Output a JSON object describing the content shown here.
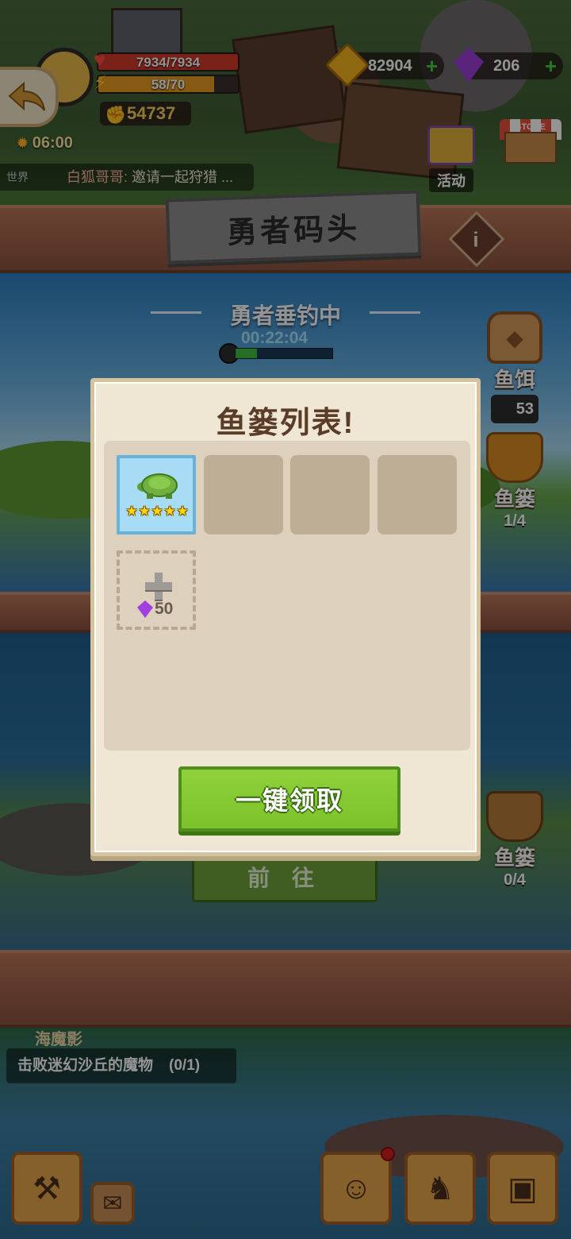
{
  "hud": {
    "hp": "7934/7934",
    "xp": "58/70",
    "power": "54737",
    "clock": "06:00",
    "gold": "82904",
    "gems": "206",
    "chat_channel": "世界",
    "chat_name": "白狐哥哥:",
    "chat_text": " 邀请一起狩猎 ...",
    "activity_label": "活动",
    "store_label": "STORE"
  },
  "header": {
    "title": "勇者码头",
    "info_label": "i"
  },
  "fishing": {
    "status": "勇者垂钓中",
    "timer": "00:22:04",
    "progress": 0.22,
    "bait_label": "鱼饵",
    "bait_count": "53",
    "basket_label": "鱼篓",
    "basket_count": "1/4",
    "basket2_label": "鱼篓",
    "basket2_count": "0/4",
    "goto_label": "前 往"
  },
  "quest": {
    "title": "海魔影",
    "desc": "击败迷幻沙丘的魔物",
    "progress": "(0/1)"
  },
  "modal": {
    "title": "鱼篓列表!",
    "slots": [
      {
        "item": "turtle",
        "stars": 5
      },
      {
        "item": null
      },
      {
        "item": null
      },
      {
        "item": null
      }
    ],
    "add_slot_price": "50",
    "claim_label": "一键领取"
  },
  "colors": {
    "claim_green": "#7cc22b",
    "modal_bg": "#efe6d4",
    "title_brown": "#5a3d28"
  },
  "icons": {
    "back": "back-arrow-icon",
    "coin": "gold-coin-icon",
    "gem": "purple-gem-icon",
    "heart": "heart-icon",
    "bolt": "bolt-icon",
    "star": "star-icon",
    "plus": "plus-icon"
  }
}
